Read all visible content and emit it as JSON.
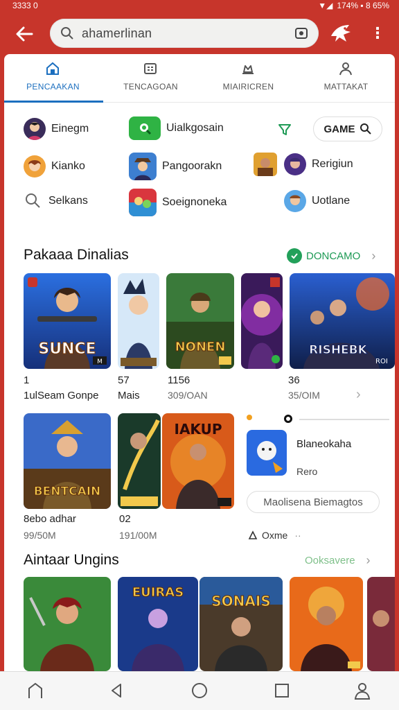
{
  "status": {
    "time": "3333 0",
    "right": "174% ▪ 8 65%"
  },
  "search": {
    "text": "ahamerlinan"
  },
  "tabs": [
    {
      "label": "PENCAAKAN",
      "icon": "home-icon"
    },
    {
      "label": "TENCAGOAN",
      "icon": "grid-icon"
    },
    {
      "label": "MIAIRICREN",
      "icon": "crown-icon"
    },
    {
      "label": "MATTAKAT",
      "icon": "person-icon"
    }
  ],
  "filters": {
    "row1": [
      "Einegm",
      "Uialkgosain"
    ],
    "game_button": "GAME",
    "row2": [
      "Kianko",
      "Pangoorakn",
      "Rerigiun"
    ],
    "row3": [
      "Selkans",
      "Soeignoneka",
      "Uotlane"
    ]
  },
  "section1": {
    "title": "Pakaaa Dinalias",
    "link": "DONCAMO",
    "cards": [
      {
        "art_text": "SUNCE",
        "badge": "M"
      },
      {
        "art_text": "",
        "badge": ""
      },
      {
        "art_text": "NONEN",
        "badge": ""
      },
      {
        "art_text": "",
        "badge": ""
      },
      {
        "art_text": "RISHEBK",
        "badge": "ROI"
      }
    ],
    "captions": [
      {
        "line1": "1",
        "line2": "1ulSeam Gonpe"
      },
      {
        "line1": "57",
        "line2": "Mais"
      },
      {
        "line1": "1156",
        "line2": "309/OAN"
      },
      {
        "line1": "36",
        "line2": "35/OIM"
      }
    ]
  },
  "section2": {
    "cards": [
      {
        "art_text": "BENTCAIN"
      },
      {
        "art_text": ""
      },
      {
        "art_text": "IAKUP"
      }
    ],
    "captions": [
      {
        "line1": "8ebo adhar",
        "line2": "99/50M"
      },
      {
        "line1": "02",
        "line2": "191/00M"
      }
    ],
    "mini": {
      "title": "Blaneokaha",
      "sub": "Rero",
      "tag": "Maolisena Biemagtos",
      "foot": "Oxme"
    }
  },
  "section3": {
    "title": "Aintaar Ungins",
    "link": "Ooksavere",
    "cards": [
      {
        "art_text": ""
      },
      {
        "art_text": "EUIRAS"
      },
      {
        "art_text": "SONAIS"
      },
      {
        "art_text": ""
      }
    ]
  },
  "colors": {
    "brand": "#c7352b",
    "accent": "#1c6fbf",
    "green": "#22a05a"
  }
}
